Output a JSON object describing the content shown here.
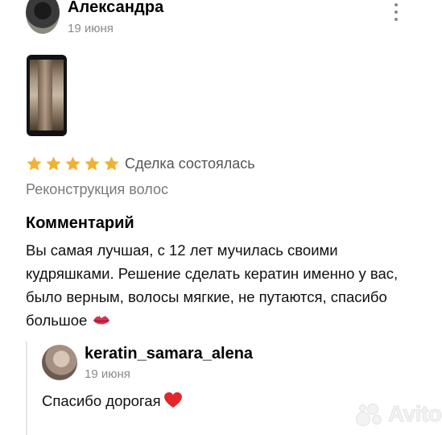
{
  "review": {
    "author": "Александра",
    "date": "19 июня",
    "rating": 5,
    "status": "Сделка состоялась",
    "service": "Реконструкция волос",
    "comment_heading": "Комментарий",
    "comment_text": "Вы самая лучшая, с 12 лет мучилась своими кудряшками. Решение сделать кератин именно у вас, было верным, волосы мягкие, не путаются, спасибо большое",
    "comment_emoji": "kiss-lips-icon"
  },
  "reply": {
    "author": "keratin_samara_alena",
    "date": "19 июня",
    "text": "Спасибо дорогая",
    "emoji": "red-heart-icon"
  },
  "watermark": {
    "text": "Avito"
  },
  "colors": {
    "star": "#f1b233",
    "muted_text": "#8a8a8a",
    "heart": "#e2262b"
  }
}
